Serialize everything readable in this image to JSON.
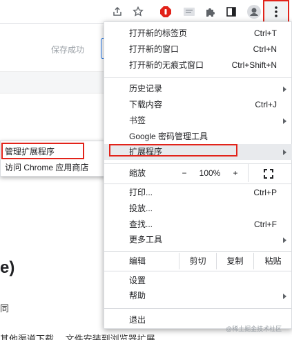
{
  "toolbar": {
    "icons": [
      "share-icon",
      "star-icon",
      "adblock-icon",
      "reader-icon",
      "extensions-puzzle-icon",
      "sidepanel-icon",
      "profile-icon",
      "more-vert-icon"
    ]
  },
  "background": {
    "save_status": "保存成功",
    "paren_text": "e)",
    "line1": "同",
    "line2": "其他渠道下载，  文件安装到浏览器扩展"
  },
  "submenu": {
    "items": [
      {
        "label": "管理扩展程序"
      },
      {
        "label": "访问 Chrome 应用商店"
      }
    ]
  },
  "menu": {
    "items": [
      {
        "label": "打开新的标签页",
        "shortcut": "Ctrl+T"
      },
      {
        "label": "打开新的窗口",
        "shortcut": "Ctrl+N"
      },
      {
        "label": "打开新的无痕式窗口",
        "shortcut": "Ctrl+Shift+N"
      },
      {
        "label": "历史记录"
      },
      {
        "label": "下载内容",
        "shortcut": "Ctrl+J"
      },
      {
        "label": "书签"
      },
      {
        "label": "Google 密码管理工具"
      },
      {
        "label": "扩展程序"
      },
      {
        "label": "打印...",
        "shortcut": "Ctrl+P"
      },
      {
        "label": "投放..."
      },
      {
        "label": "查找...",
        "shortcut": "Ctrl+F"
      },
      {
        "label": "更多工具"
      },
      {
        "label": "设置"
      },
      {
        "label": "帮助"
      },
      {
        "label": "退出"
      }
    ],
    "zoom": {
      "label": "缩放",
      "minus": "−",
      "value": "100%",
      "plus": "+"
    },
    "edit": {
      "label": "编辑",
      "cut": "剪切",
      "copy": "复制",
      "paste": "粘贴"
    }
  },
  "watermark": "@稀土掘金技术社区",
  "colors": {
    "highlight_box": "#e2231a",
    "menu_active": "#e8eaed",
    "adblock_red": "#e2231a"
  }
}
